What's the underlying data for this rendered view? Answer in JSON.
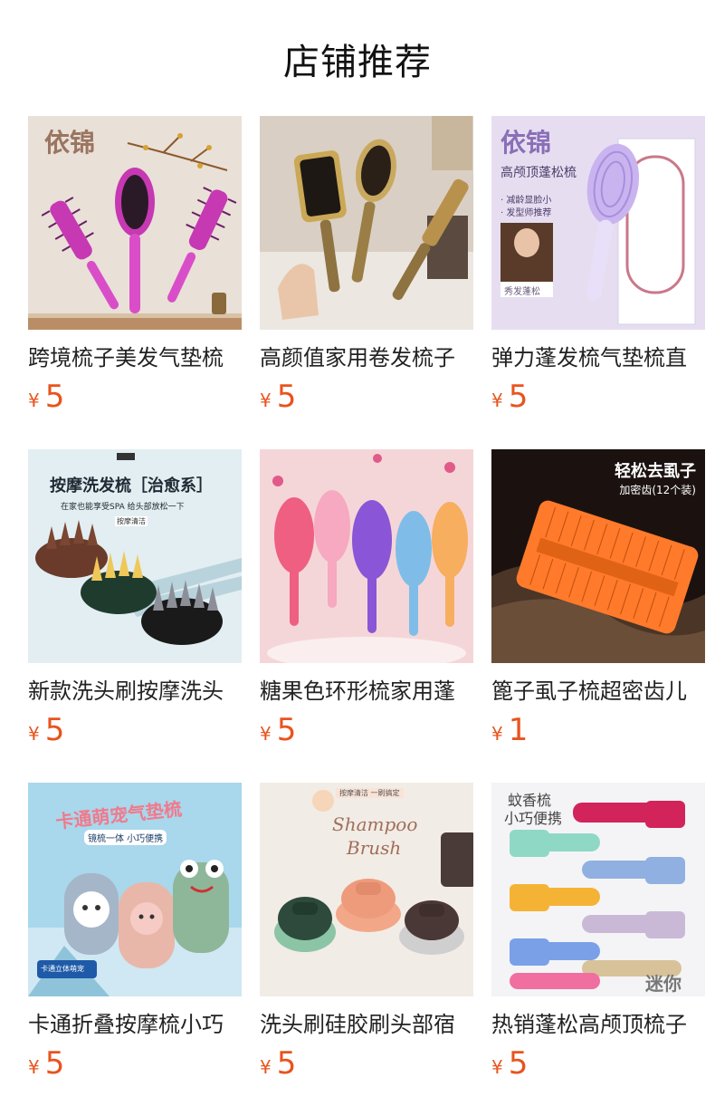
{
  "page": {
    "title": "店铺推荐"
  },
  "currency_symbol": "¥",
  "colors": {
    "price": "#e8541e",
    "title": "#111111",
    "text": "#222222"
  },
  "products": [
    {
      "name": "跨境梳子美发气垫梳",
      "price": "5",
      "thumb": {
        "bg": "#e9e0d8",
        "overlay": [
          "依锦"
        ],
        "icon": "purple-brush-set"
      }
    },
    {
      "name": "高颜值家用卷发梳子",
      "price": "5",
      "thumb": {
        "bg": "#d9cfc4",
        "overlay": [],
        "icon": "gold-brush-set"
      }
    },
    {
      "name": "弹力蓬发梳气垫梳直",
      "price": "5",
      "thumb": {
        "bg": "#e6def0",
        "overlay": [
          "依锦",
          "高颅顶蓬松梳",
          "· 减龄显脸小",
          "· 发型师推荐",
          "秀发蓬松"
        ],
        "icon": "lavender-brush-box"
      }
    },
    {
      "name": "新款洗头刷按摩洗头",
      "price": "5",
      "thumb": {
        "bg": "#e3eef2",
        "overlay": [
          "按摩洗发梳［治愈系］",
          "在家也能享受SPA 给头部放松一下",
          "按摩清洁"
        ],
        "icon": "scalp-massager-stack"
      }
    },
    {
      "name": "糖果色环形梳家用蓬",
      "price": "5",
      "thumb": {
        "bg": "#f5d6d8",
        "overlay": [],
        "icon": "candy-color-brushes"
      }
    },
    {
      "name": "篦子虱子梳超密齿儿",
      "price": "1",
      "thumb": {
        "bg": "#1b1210",
        "overlay": [
          "轻松去虱子",
          "加密齿(12个装)"
        ],
        "icon": "orange-fine-comb"
      }
    },
    {
      "name": "卡通折叠按摩梳小巧",
      "price": "5",
      "thumb": {
        "bg": "#a9d7ec",
        "overlay": [
          "卡通萌宠气垫梳",
          "镜梳一体 小巧便携",
          "卡通立体萌宠"
        ],
        "icon": "cartoon-folding-brushes"
      }
    },
    {
      "name": "洗头刷硅胶刷头部宿",
      "price": "5",
      "thumb": {
        "bg": "#f2ece6",
        "overlay": [
          "按摩清洁 一刷搞定",
          "Shampoo",
          "Brush"
        ],
        "icon": "silicone-shampoo-brushes"
      }
    },
    {
      "name": "热销蓬松高颅顶梳子",
      "price": "5",
      "thumb": {
        "bg": "#f4f4f6",
        "overlay": [
          "蚊香梳",
          "小巧便携",
          "迷你"
        ],
        "icon": "mini-vent-brushes"
      }
    }
  ]
}
